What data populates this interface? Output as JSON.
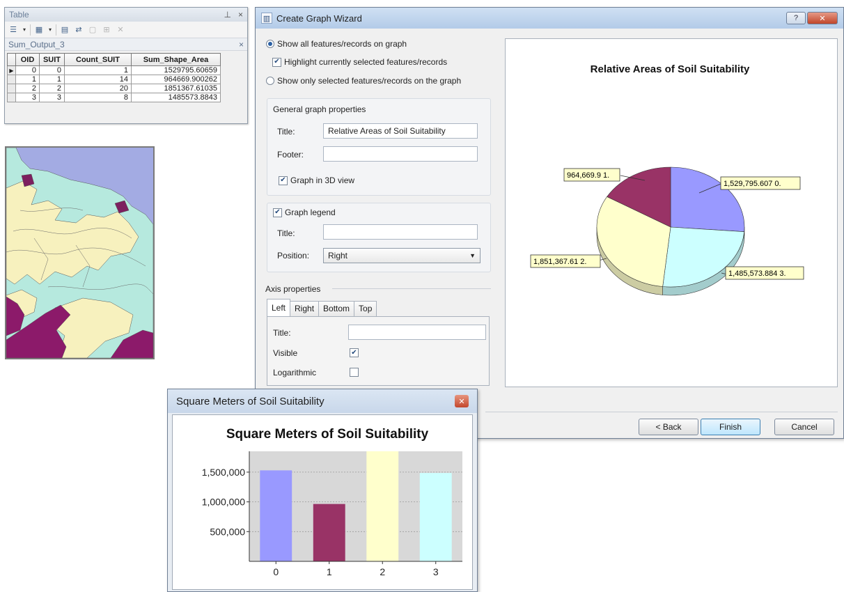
{
  "table_window": {
    "title": "Table",
    "pin_icon": "pin-icon",
    "close_label": "×",
    "tab_name": "Sum_Output_3",
    "tab_close": "×",
    "columns": [
      "OID",
      "SUIT",
      "Count_SUIT",
      "Sum_Shape_Area"
    ],
    "rows": [
      [
        "0",
        "0",
        "1",
        "1529795.60659"
      ],
      [
        "1",
        "1",
        "14",
        "964669.900262"
      ],
      [
        "2",
        "2",
        "20",
        "1851367.61035"
      ],
      [
        "3",
        "3",
        "8",
        "1485573.8843"
      ]
    ]
  },
  "map": {
    "colors": {
      "water": "#a3abe3",
      "class0": "#b6e9de",
      "class1": "#f7f1be",
      "class2": "#8c1a6a",
      "class3": "#7d1f5f"
    }
  },
  "wizard": {
    "title": "Create Graph Wizard",
    "help_label": "?",
    "close_label": "✕",
    "options": {
      "show_all": "Show all features/records on graph",
      "highlight_selected": "Highlight currently selected features/records",
      "show_only_selected": "Show only selected features/records on the graph"
    },
    "general": {
      "header": "General graph properties",
      "title_label": "Title:",
      "title_value": "Relative Areas of Soil Suitability",
      "footer_label": "Footer:",
      "footer_value": "",
      "graph3d_label": "Graph in 3D view"
    },
    "legend": {
      "header": "Graph legend",
      "title_label": "Title:",
      "title_value": "",
      "position_label": "Position:",
      "position_value": "Right"
    },
    "axis": {
      "header": "Axis properties",
      "tabs": [
        "Left",
        "Right",
        "Bottom",
        "Top"
      ],
      "title_label": "Title:",
      "title_value": "",
      "visible_label": "Visible",
      "logarithmic_label": "Logarithmic"
    },
    "buttons": {
      "back": "< Back",
      "finish": "Finish",
      "cancel": "Cancel"
    }
  },
  "pie_chart_labels": {
    "title": "Relative Areas of Soil Suitability",
    "l0": "1,529,795.607 0.",
    "l1": "964,669.9 1.",
    "l2": "1,851,367.61 2.",
    "l3": "1,485,573.884 3."
  },
  "bar_window": {
    "title": "Square Meters of Soil Suitability",
    "close_label": "✕"
  },
  "chart_data": [
    {
      "type": "pie",
      "title": "Relative Areas of Soil Suitability",
      "categories": [
        "0",
        "1",
        "2",
        "3"
      ],
      "values": [
        1529795.607,
        964669.9,
        1851367.61,
        1485573.884
      ],
      "labels": [
        "1,529,795.607 0.",
        "964,669.9 1.",
        "1,851,367.61 2.",
        "1,485,573.884 3."
      ],
      "colors": [
        "#9999ff",
        "#993366",
        "#ffffcc",
        "#ccffff"
      ],
      "view": "3D"
    },
    {
      "type": "bar",
      "title": "Square Meters of Soil Suitability",
      "categories": [
        "0",
        "1",
        "2",
        "3"
      ],
      "values": [
        1529795.607,
        964669.9,
        1851367.61,
        1485573.884
      ],
      "colors": [
        "#9999ff",
        "#993366",
        "#ffffcc",
        "#ccffff"
      ],
      "yticks": [
        "500,000",
        "1,000,000",
        "1,500,000"
      ],
      "ylim": [
        0,
        1850000
      ],
      "grid": true
    }
  ]
}
